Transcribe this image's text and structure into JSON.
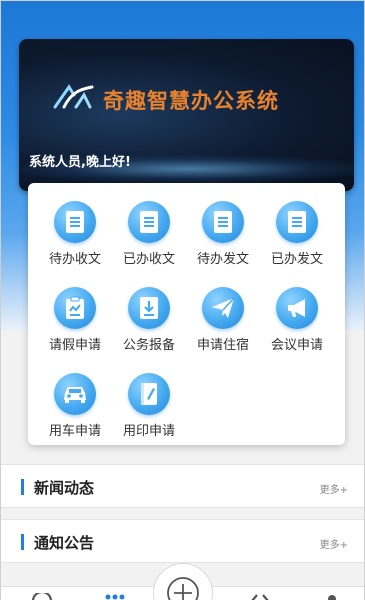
{
  "header": {
    "app_title": "奇趣智慧办公系统",
    "greeting": "系统人员,晚上好!"
  },
  "menu": {
    "items": [
      {
        "label": "待办收文",
        "icon": "document-icon"
      },
      {
        "label": "已办收文",
        "icon": "document-icon"
      },
      {
        "label": "待办发文",
        "icon": "document-icon"
      },
      {
        "label": "已办发文",
        "icon": "document-icon"
      },
      {
        "label": "请假申请",
        "icon": "leave-form-icon"
      },
      {
        "label": "公务报备",
        "icon": "download-report-icon"
      },
      {
        "label": "申请住宿",
        "icon": "paper-plane-icon"
      },
      {
        "label": "会议申请",
        "icon": "megaphone-icon"
      },
      {
        "label": "用车申请",
        "icon": "car-icon"
      },
      {
        "label": "用印申请",
        "icon": "notebook-pen-icon"
      }
    ]
  },
  "sections": {
    "news": {
      "title": "新闻动态",
      "more": "更多+"
    },
    "notice": {
      "title": "通知公告",
      "more": "更多+"
    }
  },
  "colors": {
    "accent_blue": "#1e7fdc",
    "title_orange": "#e9822c",
    "banner_dark": "#0d1a2f"
  }
}
